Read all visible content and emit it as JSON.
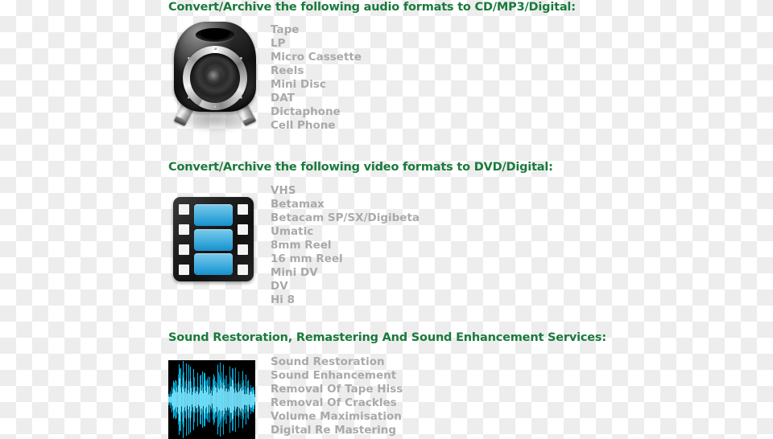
{
  "colors": {
    "heading_green": "#1a7a3c",
    "list_gray": "#a9a9a9",
    "film_blue": "#56b9e3",
    "waveform_cyan": "#00c8ff",
    "checker_light": "#ffffff",
    "checker_dark": "#ededed"
  },
  "sections": [
    {
      "id": "audio",
      "heading": "Convert/Archive the following audio formats to CD/MP3/Digital:",
      "icon": "speaker-icon",
      "items": [
        "Tape",
        "LP",
        "Micro Cassette",
        "Reels",
        "Mini Disc",
        "DAT",
        "Dictaphone",
        "Cell Phone"
      ]
    },
    {
      "id": "video",
      "heading": "Convert/Archive the following video formats to DVD/Digital:",
      "icon": "film-strip-icon",
      "items": [
        "VHS",
        "Betamax",
        "Betacam SP/SX/Digibeta",
        "Umatic",
        "8mm Reel",
        "16 mm Reel",
        "Mini DV",
        "DV",
        "Hi 8"
      ]
    },
    {
      "id": "restoration",
      "heading": "Sound Restoration, Remastering And Sound Enhancement Services:",
      "icon": "audio-waveform-image",
      "items": [
        "Sound Restoration",
        "Sound Enhancement",
        "Removal Of Tape Hiss",
        "Removal Of Crackles",
        "Volume Maximisation",
        "Digital Re Mastering"
      ]
    }
  ]
}
